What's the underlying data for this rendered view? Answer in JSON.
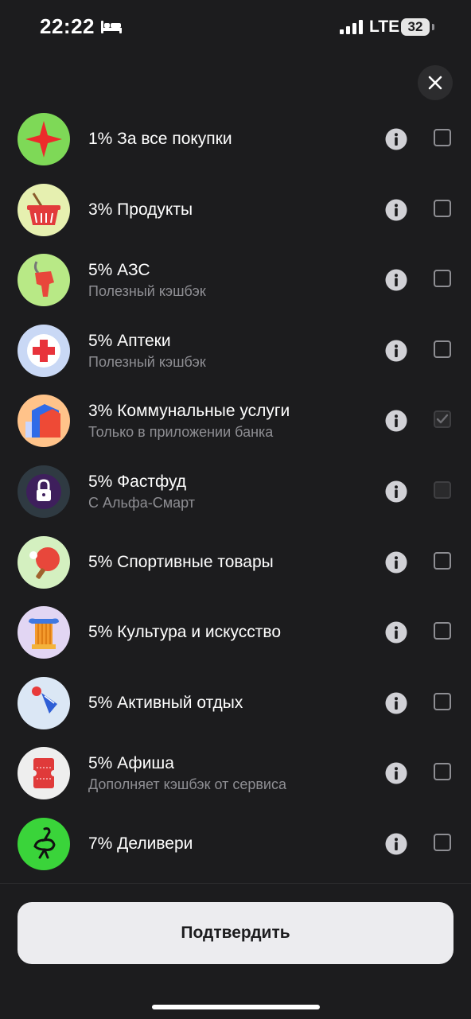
{
  "status": {
    "time": "22:22",
    "network": "LTE",
    "battery": "32",
    "icons": [
      "bed-icon",
      "cellular-signal-icon",
      "battery-icon"
    ]
  },
  "close_icon": "close-icon",
  "categories": [
    {
      "title": "1% За все покупки",
      "subtitle": "",
      "icon": "star-icon",
      "checked": false,
      "disabled": false,
      "bg": "#7ed957"
    },
    {
      "title": "3% Продукты",
      "subtitle": "",
      "icon": "basket-icon",
      "checked": false,
      "disabled": false,
      "bg": "#e6f0b0"
    },
    {
      "title": "5% АЗС",
      "subtitle": "Полезный кэшбэк",
      "icon": "fuel-nozzle-icon",
      "checked": false,
      "disabled": false,
      "bg": "#b8e986"
    },
    {
      "title": "5% Аптеки",
      "subtitle": "Полезный кэшбэк",
      "icon": "medical-cross-icon",
      "checked": false,
      "disabled": false,
      "bg": "#c9d8f5"
    },
    {
      "title": "3% Коммунальные услуги",
      "subtitle": "Только в приложении банка",
      "icon": "house-icon",
      "checked": true,
      "disabled": true,
      "bg": "#ffc38a"
    },
    {
      "title": "5% Фастфуд",
      "subtitle": "С Альфа-Смарт",
      "icon": "lock-icon",
      "checked": false,
      "disabled": true,
      "bg": "#2f3a42"
    },
    {
      "title": "5% Спортивные товары",
      "subtitle": "",
      "icon": "ping-pong-icon",
      "checked": false,
      "disabled": false,
      "bg": "#d4f0c0"
    },
    {
      "title": "5% Культура и искусство",
      "subtitle": "",
      "icon": "column-icon",
      "checked": false,
      "disabled": false,
      "bg": "#e2d6f3"
    },
    {
      "title": "5% Активный отдых",
      "subtitle": "",
      "icon": "shuttlecock-icon",
      "checked": false,
      "disabled": false,
      "bg": "#dbe7f5"
    },
    {
      "title": "5% Афиша",
      "subtitle": "Дополняет кэшбэк от сервиса",
      "icon": "ticket-icon",
      "checked": false,
      "disabled": false,
      "bg": "#eeeeee"
    },
    {
      "title": "7% Деливери",
      "subtitle": "",
      "icon": "ostrich-icon",
      "checked": false,
      "disabled": false,
      "bg": "#3ad43a"
    }
  ],
  "confirm_label": "Подтвердить"
}
